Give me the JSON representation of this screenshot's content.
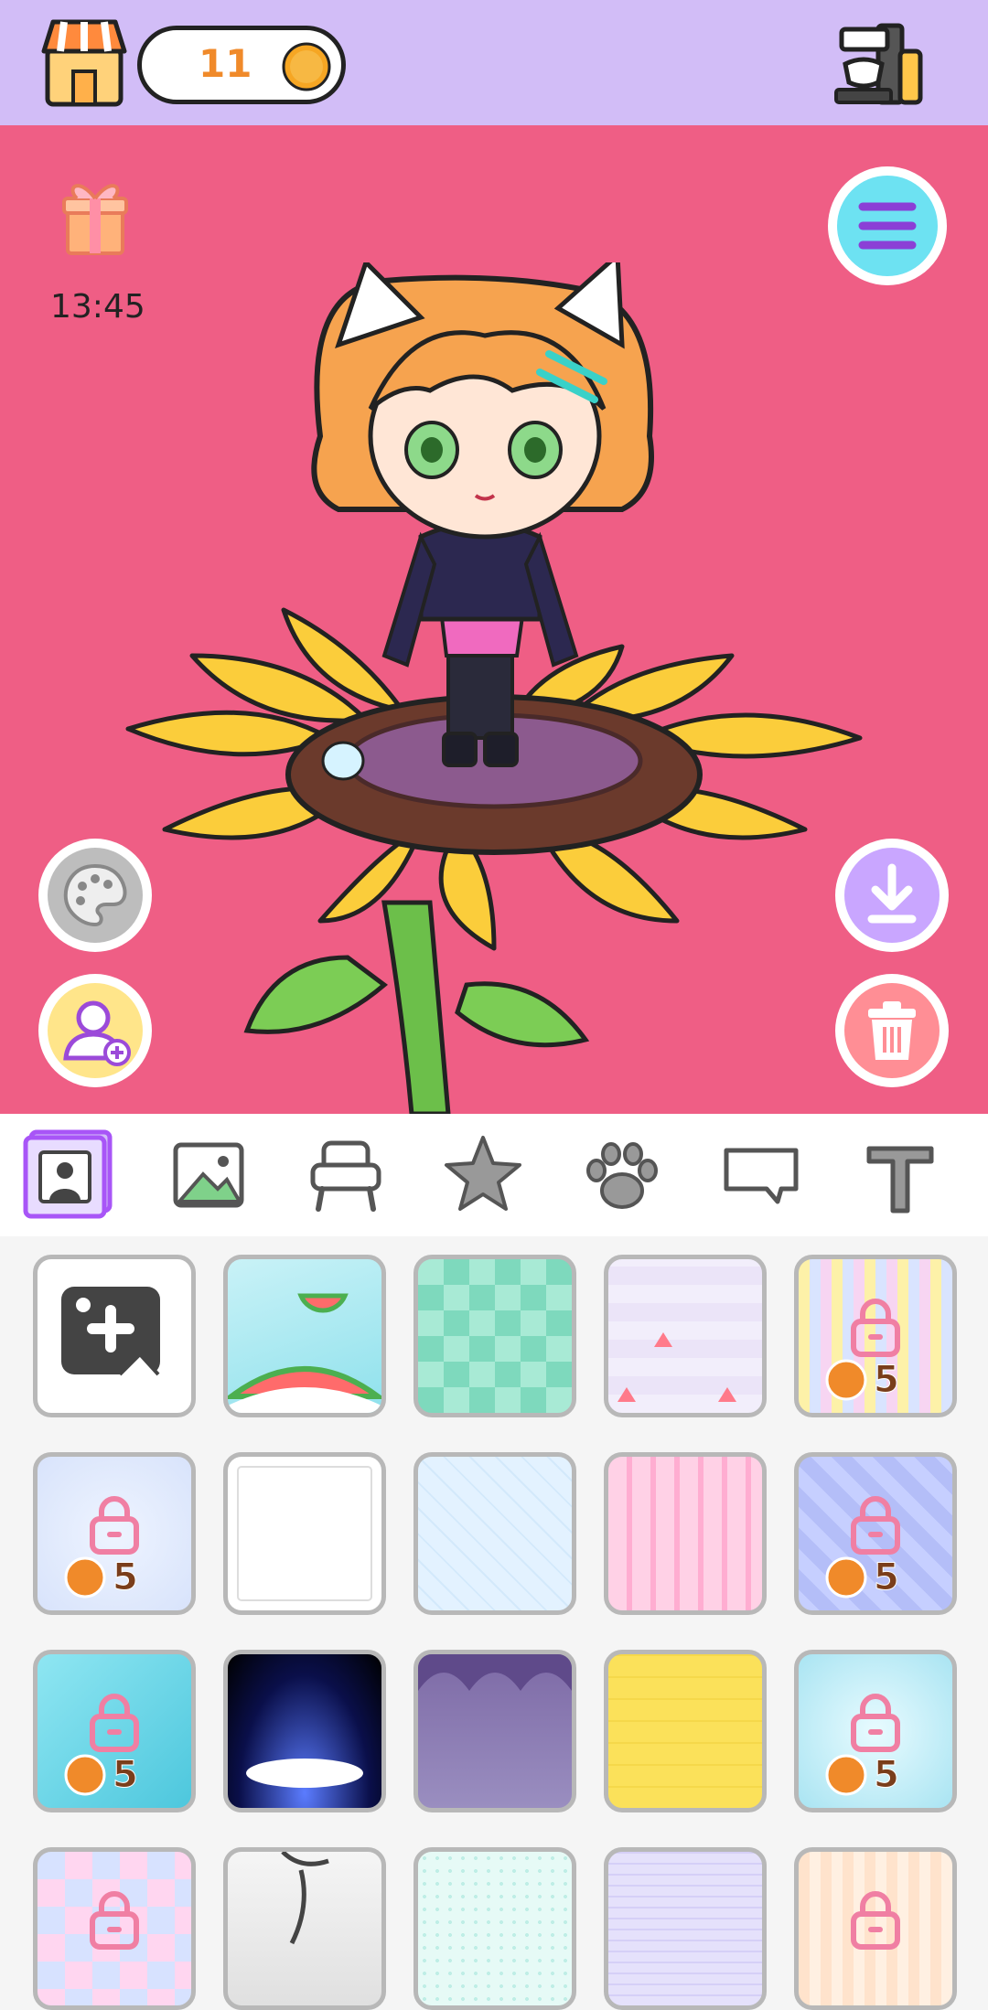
{
  "topbar": {
    "coins": "11",
    "coin_symbol": "S",
    "icons": [
      "shop-icon",
      "coin-icon",
      "vending-station-icon"
    ]
  },
  "stage": {
    "timer": "13:45",
    "icons": [
      "gift-icon",
      "menu-icon",
      "palette-icon",
      "add-character-icon",
      "download-icon",
      "trash-icon"
    ]
  },
  "tabs": [
    {
      "icon": "portrait-tab-icon",
      "selected": true
    },
    {
      "icon": "landscape-tab-icon",
      "selected": false
    },
    {
      "icon": "chair-tab-icon",
      "selected": false
    },
    {
      "icon": "star-tab-icon",
      "selected": false
    },
    {
      "icon": "paw-tab-icon",
      "selected": false
    },
    {
      "icon": "speech-bubble-tab-icon",
      "selected": false
    },
    {
      "icon": "text-tab-icon",
      "selected": false
    }
  ],
  "backgrounds": {
    "price": "5",
    "coin_symbol": "S",
    "items": [
      {
        "icon": "add-image-icon",
        "locked": false
      },
      {
        "icon": "watermelon-sky-bg",
        "locked": false
      },
      {
        "icon": "green-checker-bg",
        "locked": false
      },
      {
        "icon": "watermelon-pattern-bg",
        "locked": false
      },
      {
        "icon": "pastel-stripes-bg",
        "locked": true
      },
      {
        "icon": "starry-blue-bg",
        "locked": true
      },
      {
        "icon": "white-dotted-bg",
        "locked": false
      },
      {
        "icon": "light-blue-grid-bg",
        "locked": false
      },
      {
        "icon": "pink-stripes-bg",
        "locked": false
      },
      {
        "icon": "purple-plaid-bg",
        "locked": true
      },
      {
        "icon": "pool-water-bg",
        "locked": true
      },
      {
        "icon": "spotlight-stage-bg",
        "locked": false
      },
      {
        "icon": "purple-curtain-bg",
        "locked": false
      },
      {
        "icon": "yellow-notepad-bg",
        "locked": false
      },
      {
        "icon": "sparkle-bubble-bg",
        "locked": true
      },
      {
        "icon": "harlequin-bg",
        "locked": true
      },
      {
        "icon": "ink-tree-bg",
        "locked": false
      },
      {
        "icon": "mint-dots-bg",
        "locked": false
      },
      {
        "icon": "lilac-gingham-bg",
        "locked": false
      },
      {
        "icon": "peach-gingham-bg",
        "locked": true
      }
    ]
  },
  "colors": {
    "topbar": "#d2bdf7",
    "stage": "#ef5e85",
    "accent_purple": "#a855f7",
    "coin_orange": "#f08a2a"
  }
}
